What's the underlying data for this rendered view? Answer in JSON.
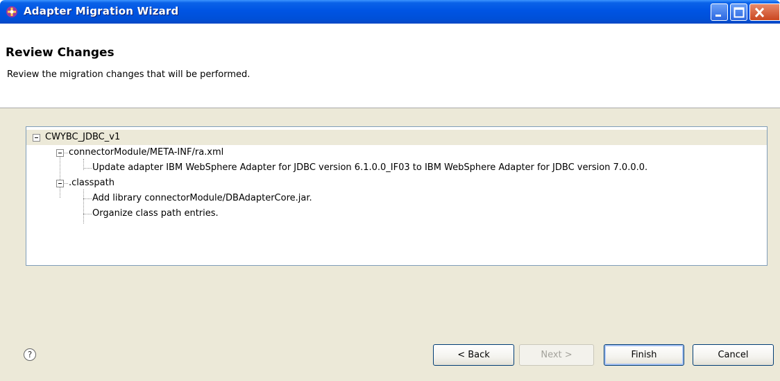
{
  "window": {
    "title": "Adapter Migration Wizard"
  },
  "header": {
    "title": "Review Changes",
    "description": "Review the migration changes that will be performed."
  },
  "tree": {
    "root": {
      "label": "CWYBC_JDBC_v1",
      "children": [
        {
          "label": "connectorModule/META-INF/ra.xml",
          "children": [
            {
              "label": "Update adapter IBM WebSphere Adapter for JDBC version 6.1.0.0_IF03 to IBM WebSphere Adapter for JDBC version 7.0.0.0."
            }
          ]
        },
        {
          "label": ".classpath",
          "children": [
            {
              "label": "Add library connectorModule/DBAdapterCore.jar."
            },
            {
              "label": "Organize class path entries."
            }
          ]
        }
      ]
    }
  },
  "footer": {
    "help_label": "?",
    "back_label": "< Back",
    "next_label": "Next >",
    "finish_label": "Finish",
    "cancel_label": "Cancel"
  }
}
